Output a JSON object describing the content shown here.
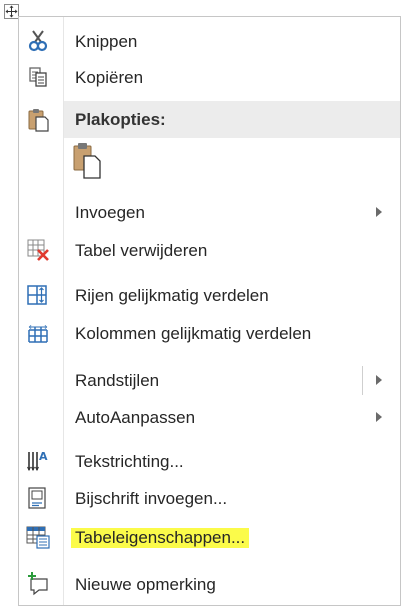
{
  "menu": {
    "items": [
      {
        "label": "Knippen",
        "icon": "scissors-icon"
      },
      {
        "label": "Kopiëren",
        "icon": "copy-icon"
      },
      {
        "label": "Plakopties:",
        "icon": "clipboard-icon"
      },
      {
        "label": "Invoegen",
        "has_submenu": true
      },
      {
        "label": "Tabel verwijderen",
        "icon": "delete-table-icon"
      },
      {
        "label": "Rijen gelijkmatig verdelen",
        "icon": "distribute-rows-icon"
      },
      {
        "label": "Kolommen gelijkmatig verdelen",
        "icon": "distribute-columns-icon"
      },
      {
        "label": "Randstijlen",
        "has_submenu": true
      },
      {
        "label": "AutoAanpassen",
        "has_submenu": true
      },
      {
        "label": "Tekstrichting...",
        "icon": "text-direction-icon"
      },
      {
        "label": "Bijschrift invoegen...",
        "icon": "insert-caption-icon"
      },
      {
        "label": "Tabeleigenschappen...",
        "icon": "table-properties-icon",
        "highlighted": true
      },
      {
        "label": "Nieuwe opmerking",
        "icon": "new-comment-icon"
      }
    ],
    "paste_option_icon": "paste-keep-text-icon"
  },
  "colors": {
    "highlight": "#fbfb4a",
    "delete_red": "#e03a2f",
    "icon_blue": "#2f6fb5"
  }
}
